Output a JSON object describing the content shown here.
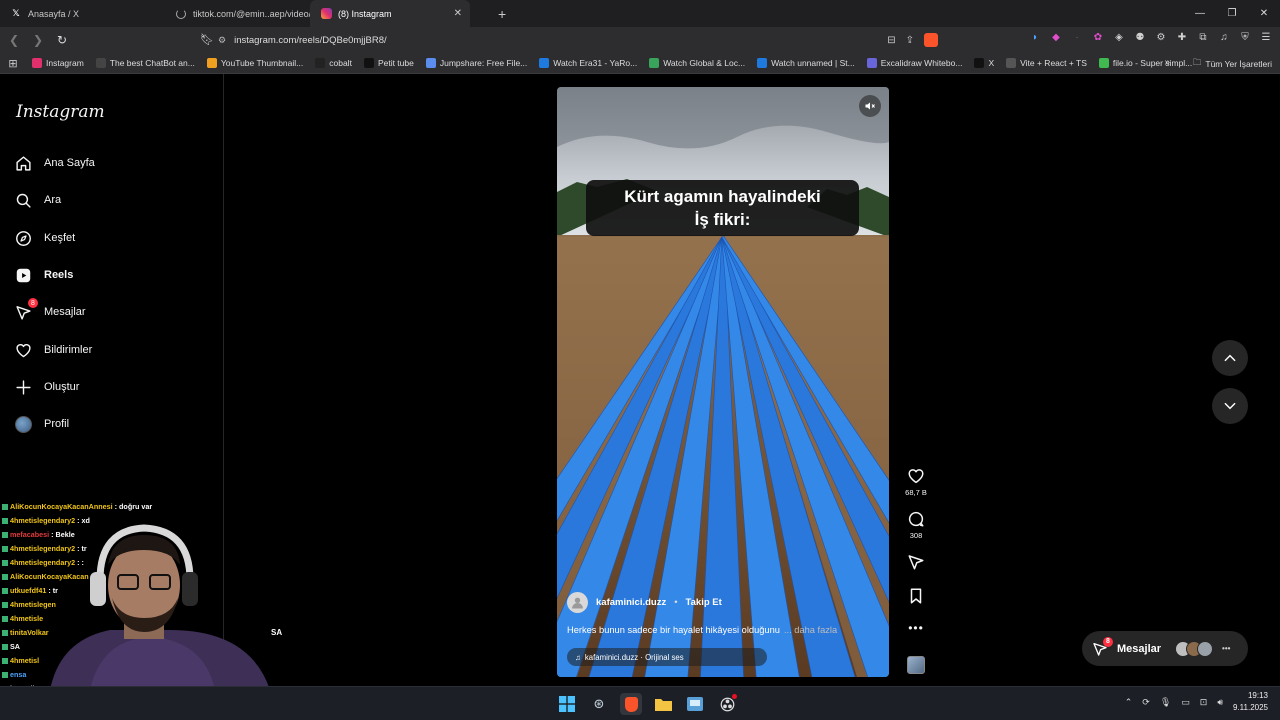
{
  "browser": {
    "tabs": [
      {
        "title": "Anasayfa / X",
        "icon": "x-logo-icon"
      },
      {
        "title": "tiktok.com/@emin..aep/video/755",
        "icon": "loading-spinner-icon"
      },
      {
        "title": "(8) Instagram",
        "icon": "instagram-icon",
        "active": true
      }
    ],
    "url": "instagram.com/reels/DQBe0mjjBR8/",
    "bookmarks": [
      {
        "label": "Instagram",
        "color": "#e1306c"
      },
      {
        "label": "The best ChatBot an...",
        "color": "#444"
      },
      {
        "label": "YouTube Thumbnail...",
        "color": "#f0a020"
      },
      {
        "label": "cobalt",
        "color": "#222"
      },
      {
        "label": "Petit tube",
        "color": "#111"
      },
      {
        "label": "Jumpshare: Free File...",
        "color": "#5b8def"
      },
      {
        "label": "Watch Era31 - YaRo...",
        "color": "#1f7ae0"
      },
      {
        "label": "Watch Global & Loc...",
        "color": "#3aa35b"
      },
      {
        "label": "Watch unnamed | St...",
        "color": "#1f7ae0"
      },
      {
        "label": "Excalidraw Whitebo...",
        "color": "#6965db"
      },
      {
        "label": "X",
        "color": "#111"
      },
      {
        "label": "Vite + React + TS",
        "color": "#555"
      },
      {
        "label": "file.io - Super simpl...",
        "color": "#3fb950"
      }
    ],
    "bookmarks_folder": "Tüm Yer İşaretleri"
  },
  "sidebar": {
    "logo": "Instagram",
    "items": [
      {
        "label": "Ana Sayfa",
        "icon": "home-icon"
      },
      {
        "label": "Ara",
        "icon": "search-icon"
      },
      {
        "label": "Keşfet",
        "icon": "compass-icon"
      },
      {
        "label": "Reels",
        "icon": "reels-icon",
        "active": true
      },
      {
        "label": "Mesajlar",
        "icon": "messenger-icon",
        "badge": "8"
      },
      {
        "label": "Bildirimler",
        "icon": "heart-icon"
      },
      {
        "label": "Oluştur",
        "icon": "plus-icon"
      },
      {
        "label": "Profil",
        "icon": "avatar"
      }
    ]
  },
  "reel": {
    "overlay_text": "Kürt agamın hayalindeki\nİş fikri:",
    "author": "kafaminici.duzz",
    "follow_label": "Takip Et",
    "description": "Herkes bunun sadece bir hayalet hikâyesi olduğunu",
    "more_label": "... daha fazla",
    "audio": "kafaminici.duzz · Orijinal ses",
    "likes": "68,7 B",
    "comments": "308"
  },
  "messages_pill": {
    "label": "Mesajlar",
    "badge": "8"
  },
  "stream_chat": [
    {
      "user": "AliKocunKocayaKacanAnnesi",
      "msg": "doğru var",
      "color": "#f0c419"
    },
    {
      "user": "4hmetislegendary2",
      "msg": "xd",
      "color": "#f0c419"
    },
    {
      "user": "mefacabesi",
      "msg": "Bekle",
      "color": "#e23b3b"
    },
    {
      "user": "4hmetislegendary2",
      "msg": "tr",
      "color": "#f0c419"
    },
    {
      "user": "4hmetislegendary2",
      "msg": ":",
      "color": "#f0c419"
    },
    {
      "user": "AliKocunKocayaKacan",
      "msg": "",
      "color": "#f0c419"
    },
    {
      "user": "utkuefdf41",
      "msg": "tr",
      "color": "#f0c419"
    },
    {
      "user": "4hmetislegen",
      "msg": "",
      "color": "#f0c419"
    },
    {
      "user": "4hmetisle",
      "msg": "",
      "color": "#f0c419"
    },
    {
      "user": "tinitaVolkar",
      "msg": "",
      "color": "#f0c419"
    },
    {
      "user": "SA",
      "msg": "",
      "color": "#ffffff"
    },
    {
      "user": "4hmetisl",
      "msg": "",
      "color": "#f0c419"
    },
    {
      "user": "ensa",
      "msg": "",
      "color": "#4aa3ff"
    },
    {
      "user": "https://ww",
      "msg": "",
      "color": "#ffffff"
    },
    {
      "user": "THEOD",
      "msg": "",
      "color": "#e23b3b"
    }
  ],
  "webcam_label": "SA",
  "taskbar": {
    "time": "19:13",
    "date": "9.11.2025"
  }
}
